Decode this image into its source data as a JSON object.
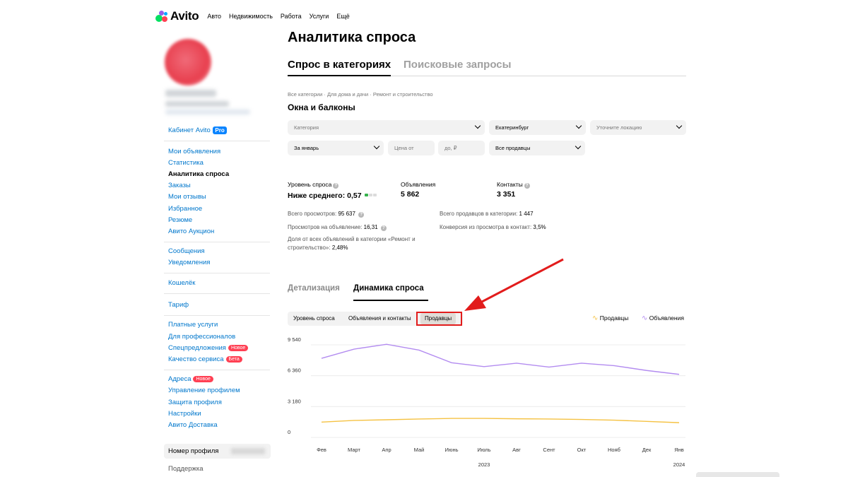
{
  "brand": {
    "name": "Avito"
  },
  "topnav": {
    "links": [
      "Авто",
      "Недвижимость",
      "Работа",
      "Услуги",
      "Ещё"
    ]
  },
  "sidebar": {
    "cabinet_label": "Кабинет",
    "cabinet_brand": "Avito",
    "pro_badge": "Pro",
    "group1": [
      "Мои объявления",
      "Статистика",
      "Аналитика спроса",
      "Заказы",
      "Мои отзывы",
      "Избранное",
      "Резюме",
      "Авито Аукцион"
    ],
    "group2": [
      "Сообщения",
      "Уведомления"
    ],
    "group3": [
      "Кошелёк"
    ],
    "group4": [
      "Тариф"
    ],
    "group5": [
      "Платные услуги",
      "Для профессионалов",
      "Спецпредложения",
      "Качество сервиса"
    ],
    "badge_new": "Новое",
    "badge_beta": "Бета",
    "group6": [
      "Адреса",
      "Управление профилем",
      "Защита профиля",
      "Настройки",
      "Авито Доставка"
    ],
    "profile_number_label": "Номер профиля",
    "support": "Поддержка"
  },
  "main": {
    "title": "Аналитика спроса",
    "tabs": [
      "Спрос в категориях",
      "Поисковые запросы"
    ],
    "breadcrumb": "Все категории · Для дома и дачи · Ремонт и строительство",
    "category": "Окна и балконы",
    "filters": {
      "category_placeholder": "Категория",
      "city": "Екатеринбург",
      "location_placeholder": "Уточните локацию",
      "period": "За январь",
      "price_from": "Цена от",
      "price_to": "до, ₽",
      "sellers": "Все продавцы"
    },
    "stats": {
      "demand_label": "Уровень спроса",
      "demand_value": "Ниже среднего: 0,57",
      "ads_label": "Объявления",
      "ads_value": "5 862",
      "contacts_label": "Контакты",
      "contacts_value": "3 351"
    },
    "meta": {
      "views_label": "Всего просмотров:",
      "views_value": "95 637",
      "per_ad_label": "Просмотров на объявление:",
      "per_ad_value": "16,31",
      "share_label_1": "Доля от всех объявлений в категории «Ремонт и",
      "share_label_2": "строительство»:",
      "share_value": "2,48%",
      "sellers_label": "Всего продавцов в категории:",
      "sellers_value": "1 447",
      "conversion_label": "Конверсия из просмотра в контакт:",
      "conversion_value": "3,5%"
    },
    "subtabs": [
      "Детализация",
      "Динамика спроса"
    ],
    "segments": [
      "Уровень спроса",
      "Объявления и контакты",
      "Продавцы"
    ],
    "legend": [
      "Продавцы",
      "Объявления"
    ]
  },
  "colors": {
    "sellers_line": "#f5c243",
    "ads_line": "#b38cf0",
    "link": "#0077cc",
    "highlight": "#e21c1c"
  },
  "chart_data": {
    "type": "line",
    "categories": [
      "Фев",
      "Март",
      "Апр",
      "Май",
      "Июнь",
      "Июль",
      "Авг",
      "Сент",
      "Окт",
      "Нояб",
      "Дек",
      "Янв"
    ],
    "year_labels": [
      "2023",
      "2024"
    ],
    "y_ticks": [
      "0",
      "3 180",
      "6 360",
      "9 540"
    ],
    "ylim": [
      0,
      9540
    ],
    "grid": true,
    "legend_position": "top-right",
    "series": [
      {
        "name": "Продавцы",
        "values": [
          1580,
          1750,
          1820,
          1900,
          1960,
          1960,
          1920,
          1900,
          1850,
          1780,
          1650,
          1520
        ]
      },
      {
        "name": "Объявления",
        "values": [
          8150,
          9100,
          9600,
          9000,
          7700,
          7300,
          7650,
          7250,
          7650,
          7400,
          6900,
          6500
        ]
      }
    ]
  }
}
